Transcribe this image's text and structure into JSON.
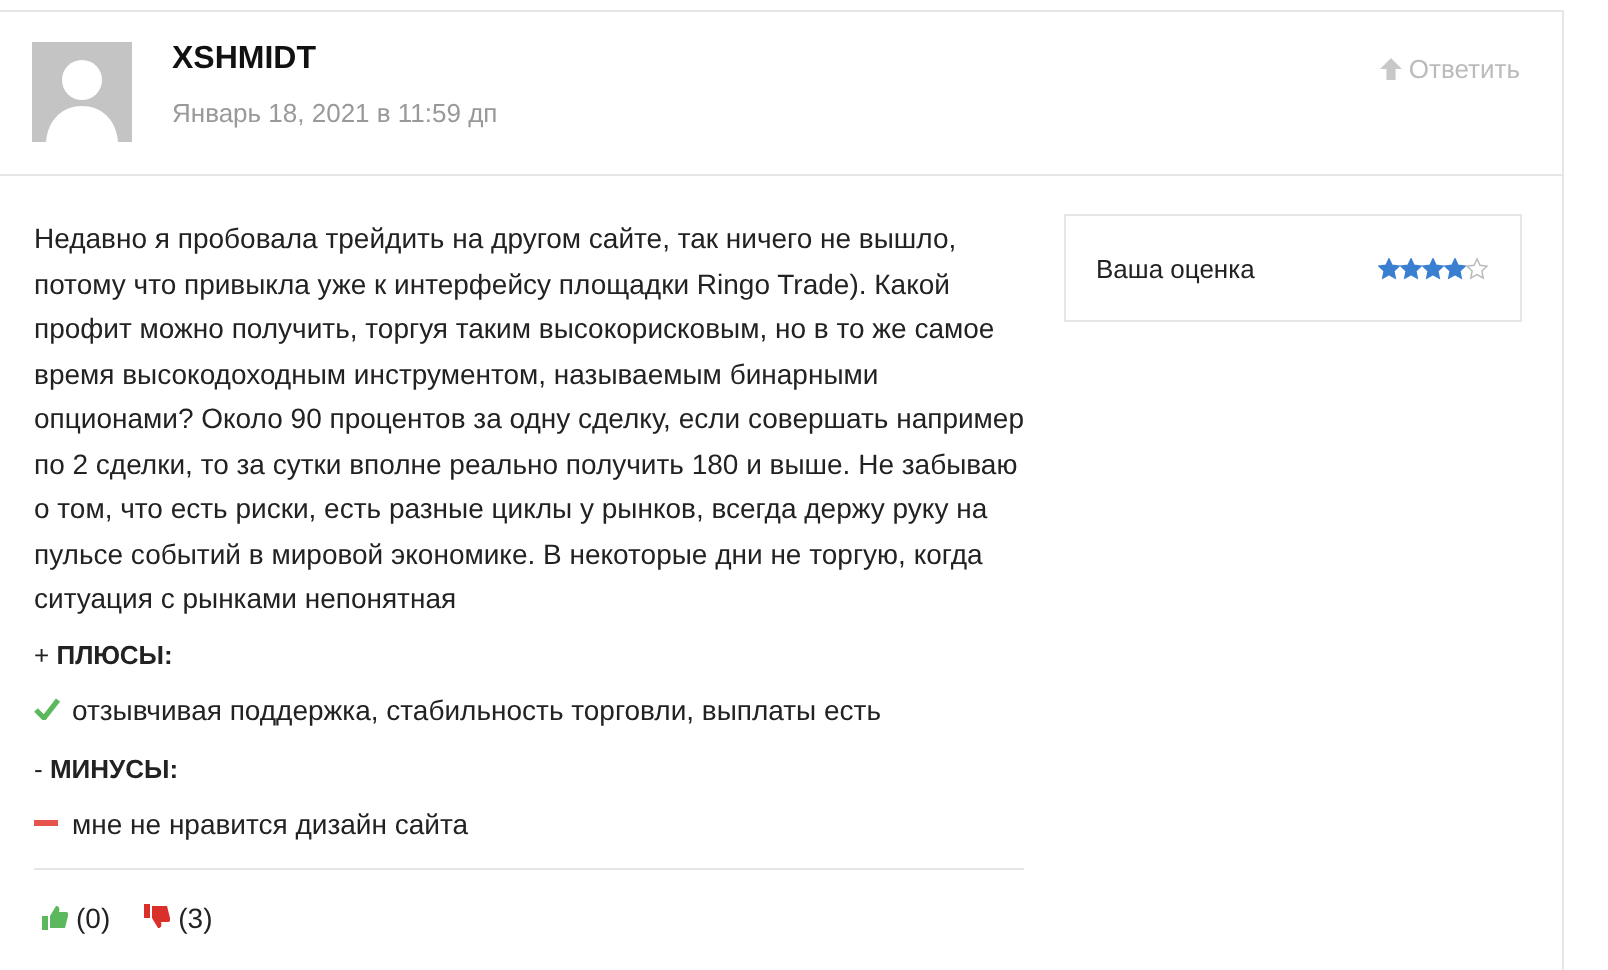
{
  "comment": {
    "author": "XSHMIDT",
    "date": "Январь 18, 2021 в 11:59 дп",
    "reply": "Ответить",
    "text": "Недавно я пробовала трейдить на другом сайте, так ничего не вышло, потому что привыкла уже к интерфейсу площадки Ringo Trade). Какой профит можно получить, торгуя таким высокорисковым, но в то же самое время высокодоходным инструментом, называемым бинарными опционами? Около 90 процентов за одну сделку, если совершать например по 2 сделки, то за сутки вполне реально получить 180 и выше. Не забываю о том, что есть риски, есть разные циклы у рынков, всегда держу руку на пульсе событий в мировой экономике. В некоторые дни не торгую, когда ситуация с рынками непонятная",
    "sections": [
      {
        "kind": "pro",
        "heading": "+ **ПЛЮСЫ:**",
        "item": "отзывчивая поддержка, стабильность торговли, выплаты есть"
      },
      {
        "kind": "con",
        "heading": "- **МИНУСЫ:**",
        "item": "мне не нравится дизайн сайта"
      }
    ],
    "votes": [
      {
        "kind": "up",
        "count": "(0)"
      },
      {
        "kind": "down",
        "count": "(3)"
      }
    ],
    "rating": {
      "label": "Ваша оценка",
      "stars": 4
    }
  }
}
